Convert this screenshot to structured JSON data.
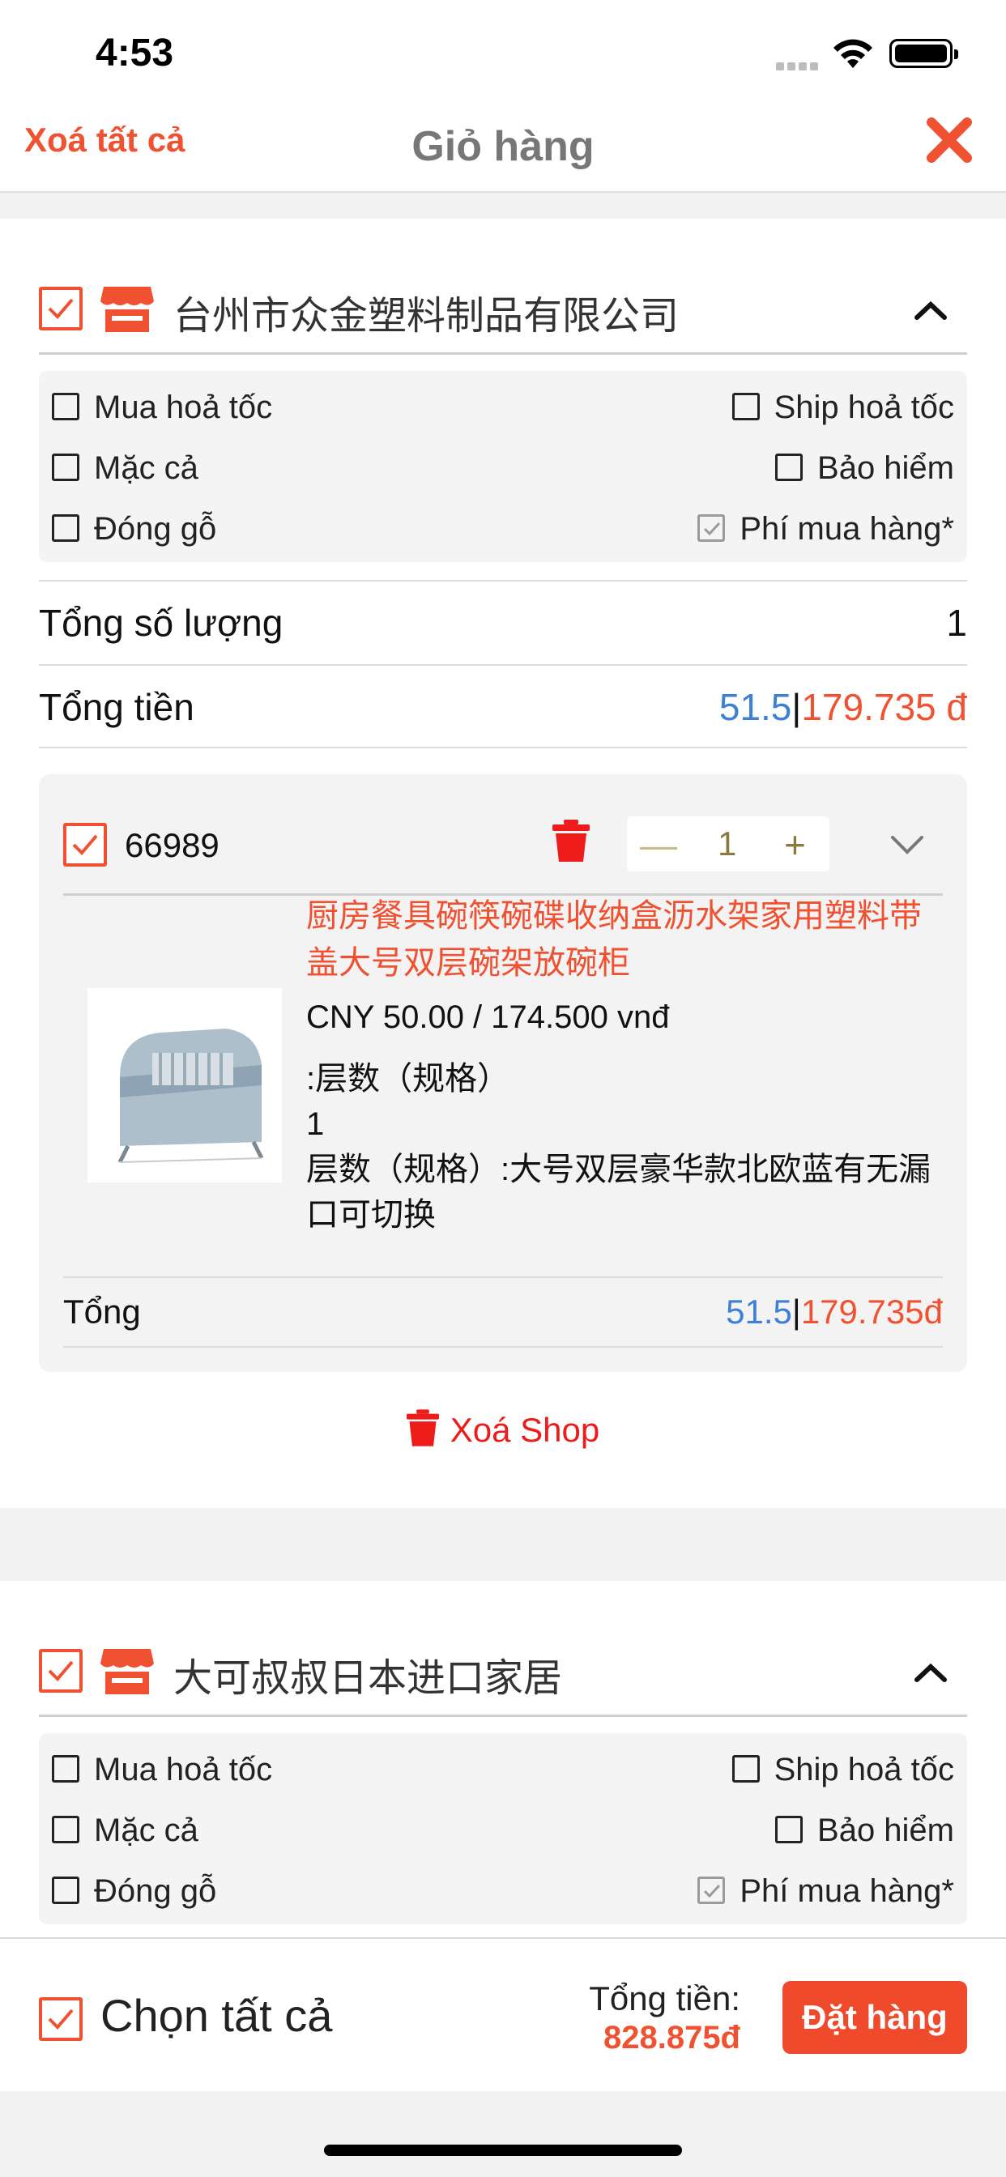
{
  "status_bar": {
    "time": "4:53"
  },
  "nav": {
    "clear_all": "Xoá tất cả",
    "title": "Giỏ hàng"
  },
  "options": {
    "fast_buy": "Mua hoả tốc",
    "fast_ship": "Ship hoả tốc",
    "bargain": "Mặc cả",
    "insurance": "Bảo hiểm",
    "wood_pack": "Đóng gỗ",
    "purchase_fee": "Phí mua hàng*"
  },
  "shops": [
    {
      "name": "台州市众金塑料制品有限公司",
      "total_qty_label": "Tổng số lượng",
      "total_qty": "1",
      "total_label": "Tổng tiền",
      "total_cny": "51.5",
      "separator": "|",
      "total_vnd": "179.735 đ",
      "product": {
        "id": "66989",
        "qty": "1",
        "name": "厨房餐具碗筷碗碟收纳盒沥水架家用塑料带盖大号双层碗架放碗柜",
        "price": "CNY 50.00 / 174.500 vnđ",
        "attr_line1": ":层数（规格）",
        "attr_line2": "1",
        "attr_line3": "层数（规格）:大号双层豪华款北欧蓝有无漏口可切换",
        "total_label": "Tổng",
        "total_cny": "51.5",
        "total_vnd": "179.735đ"
      },
      "delete_shop": "Xoá Shop"
    },
    {
      "name": "大可叔叔日本进口家居"
    }
  ],
  "bottom": {
    "select_all": "Chọn tất cả",
    "total_label": "Tổng tiền:",
    "total_value": "828.875đ",
    "order_button": "Đặt hàng"
  },
  "colors": {
    "accent": "#ef5131",
    "blue": "#3d80d6",
    "delete_red": "#ee1b1b"
  }
}
